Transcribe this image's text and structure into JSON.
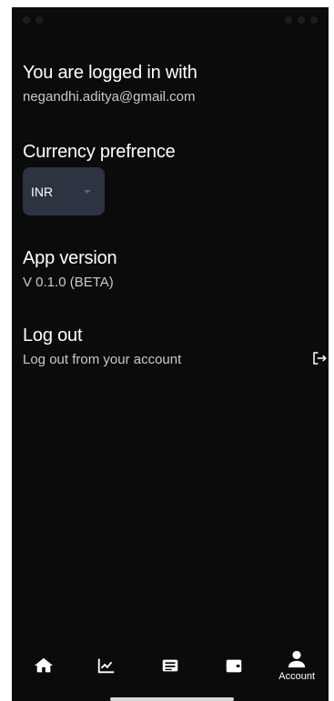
{
  "account": {
    "logged_in_title": "You are logged in with",
    "email": "negandhi.aditya@gmail.com",
    "currency_title": "Currency prefrence",
    "currency_value": "INR",
    "version_title": "App version",
    "version_value": "V 0.1.0 (BETA)",
    "logout_title": "Log out",
    "logout_sub": "Log out from your account"
  },
  "nav": {
    "items": [
      {
        "icon": "home-icon"
      },
      {
        "icon": "chart-icon"
      },
      {
        "icon": "list-icon"
      },
      {
        "icon": "wallet-icon"
      },
      {
        "icon": "user-icon",
        "label": "Account"
      }
    ]
  },
  "colors": {
    "background": "#0b0b0b",
    "select_bg": "#2d3441",
    "text": "#ffffff",
    "subtext": "#c9c9c9"
  }
}
